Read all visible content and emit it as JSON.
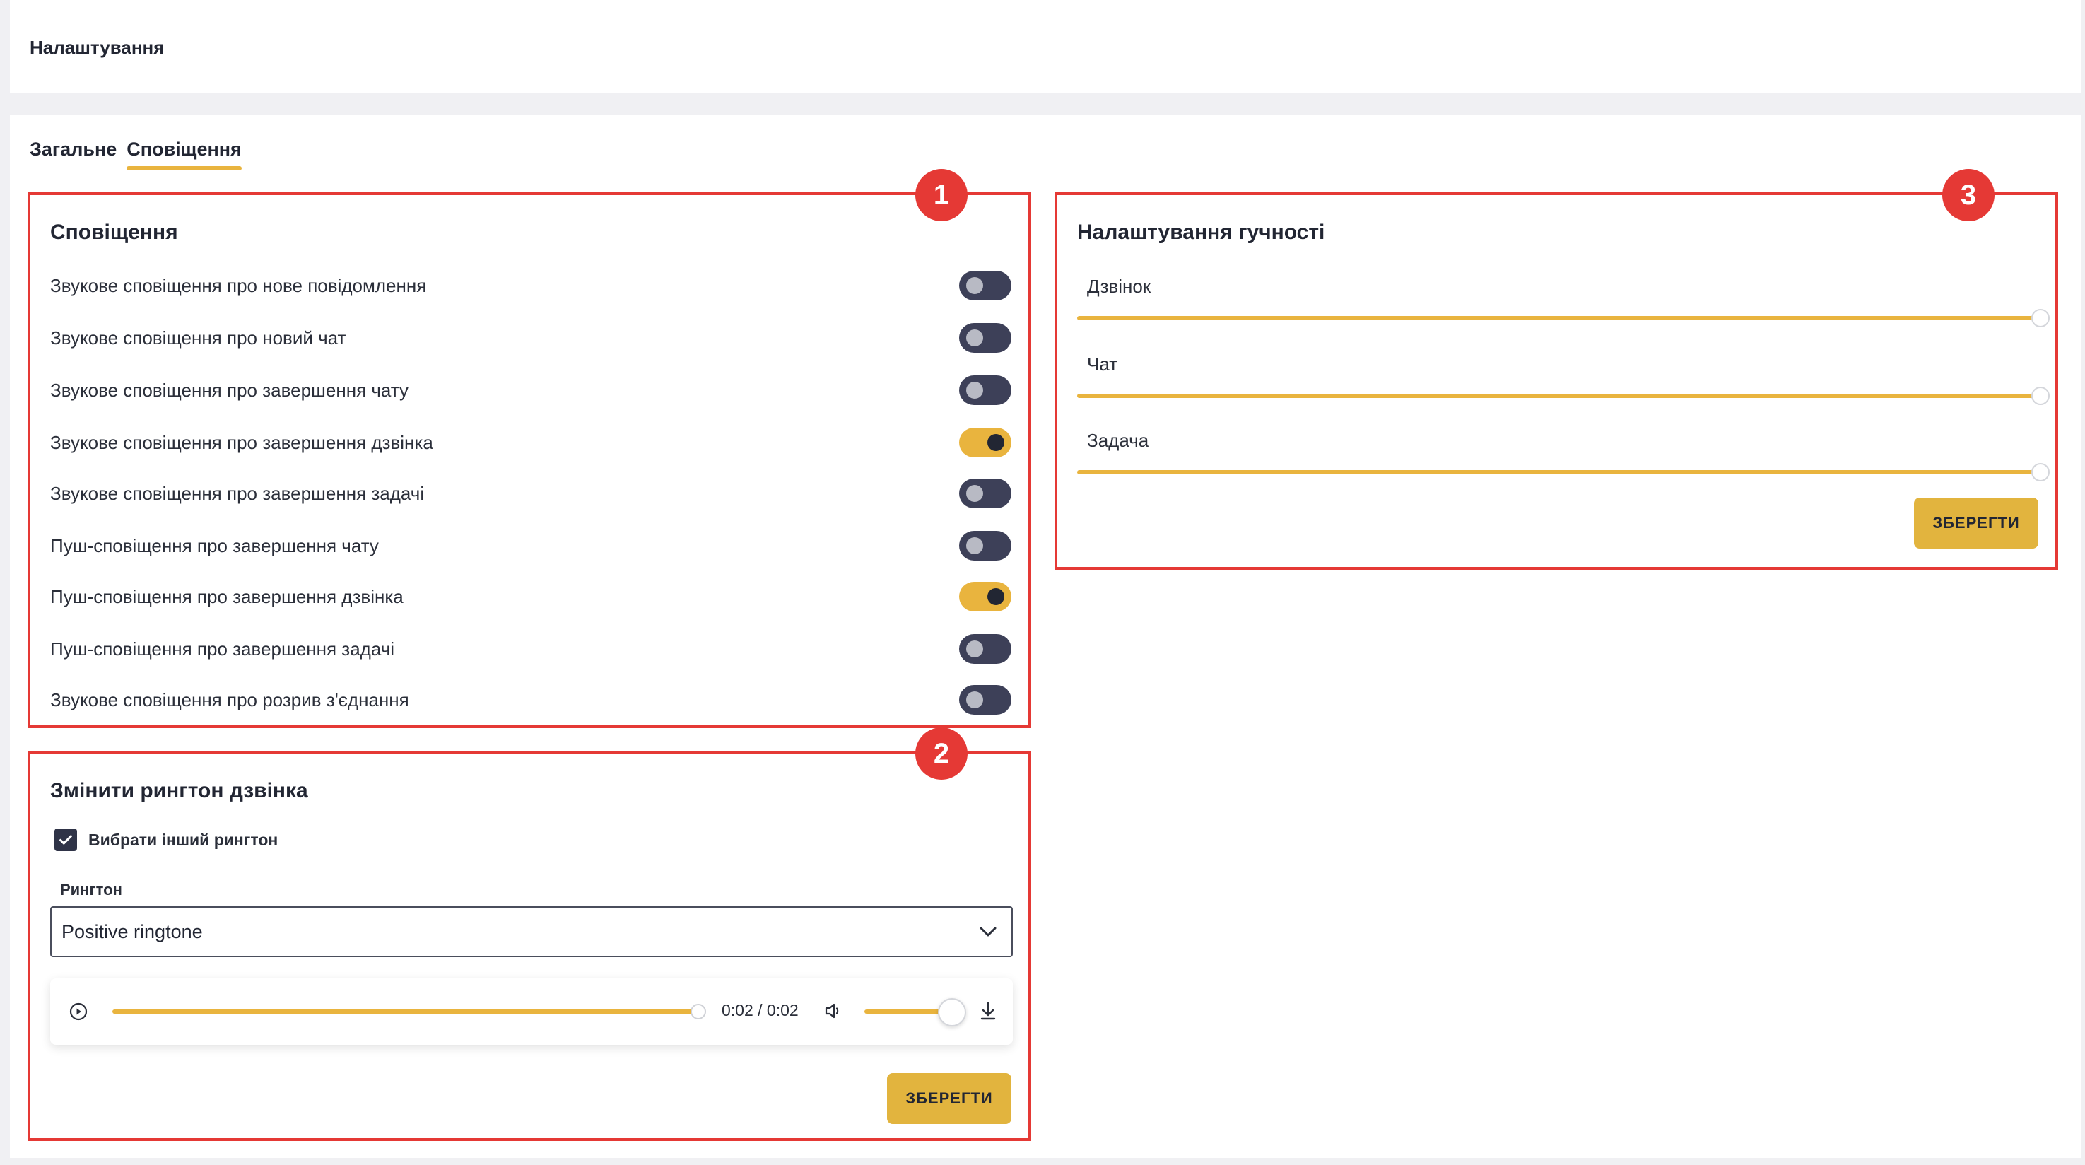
{
  "page": {
    "title": "Налаштування"
  },
  "tabs": [
    {
      "label": "Загальне",
      "active": false
    },
    {
      "label": "Сповіщення",
      "active": true
    }
  ],
  "notifications": {
    "badge": "1",
    "title": "Сповіщення",
    "items": [
      {
        "label": "Звукове сповіщення про нове повідомлення",
        "on": false
      },
      {
        "label": "Звукове сповіщення про новий чат",
        "on": false
      },
      {
        "label": "Звукове сповіщення про завершення чату",
        "on": false
      },
      {
        "label": "Звукове сповіщення про завершення дзвінка",
        "on": true
      },
      {
        "label": "Звукове сповіщення про завершення задачі",
        "on": false
      },
      {
        "label": "Пуш-сповіщення про завершення чату",
        "on": false
      },
      {
        "label": "Пуш-сповіщення про завершення дзвінка",
        "on": true
      },
      {
        "label": "Пуш-сповіщення про завершення задачі",
        "on": false
      },
      {
        "label": "Звукове сповіщення про розрив з'єднання",
        "on": false
      }
    ]
  },
  "ringtone": {
    "badge": "2",
    "title": "Змінити рингтон дзвінка",
    "checkbox_label": "Вибрати інший рингтон",
    "checkbox_checked": true,
    "select_label": "Рингтон",
    "select_value": "Positive ringtone",
    "player": {
      "time": "0:02 / 0:02",
      "progress": 1.0,
      "volume": 1.0
    },
    "save_label": "ЗБЕРЕГТИ"
  },
  "volume": {
    "badge": "3",
    "title": "Налаштування гучності",
    "items": [
      {
        "label": "Дзвінок",
        "level": 1.0
      },
      {
        "label": "Чат",
        "level": 1.0
      },
      {
        "label": "Задача",
        "level": 1.0
      }
    ],
    "save_label": "ЗБЕРЕГТИ"
  },
  "colors": {
    "accent": "#e9b43e",
    "highlight": "#e53935",
    "toggle_off": "#3d4058"
  }
}
